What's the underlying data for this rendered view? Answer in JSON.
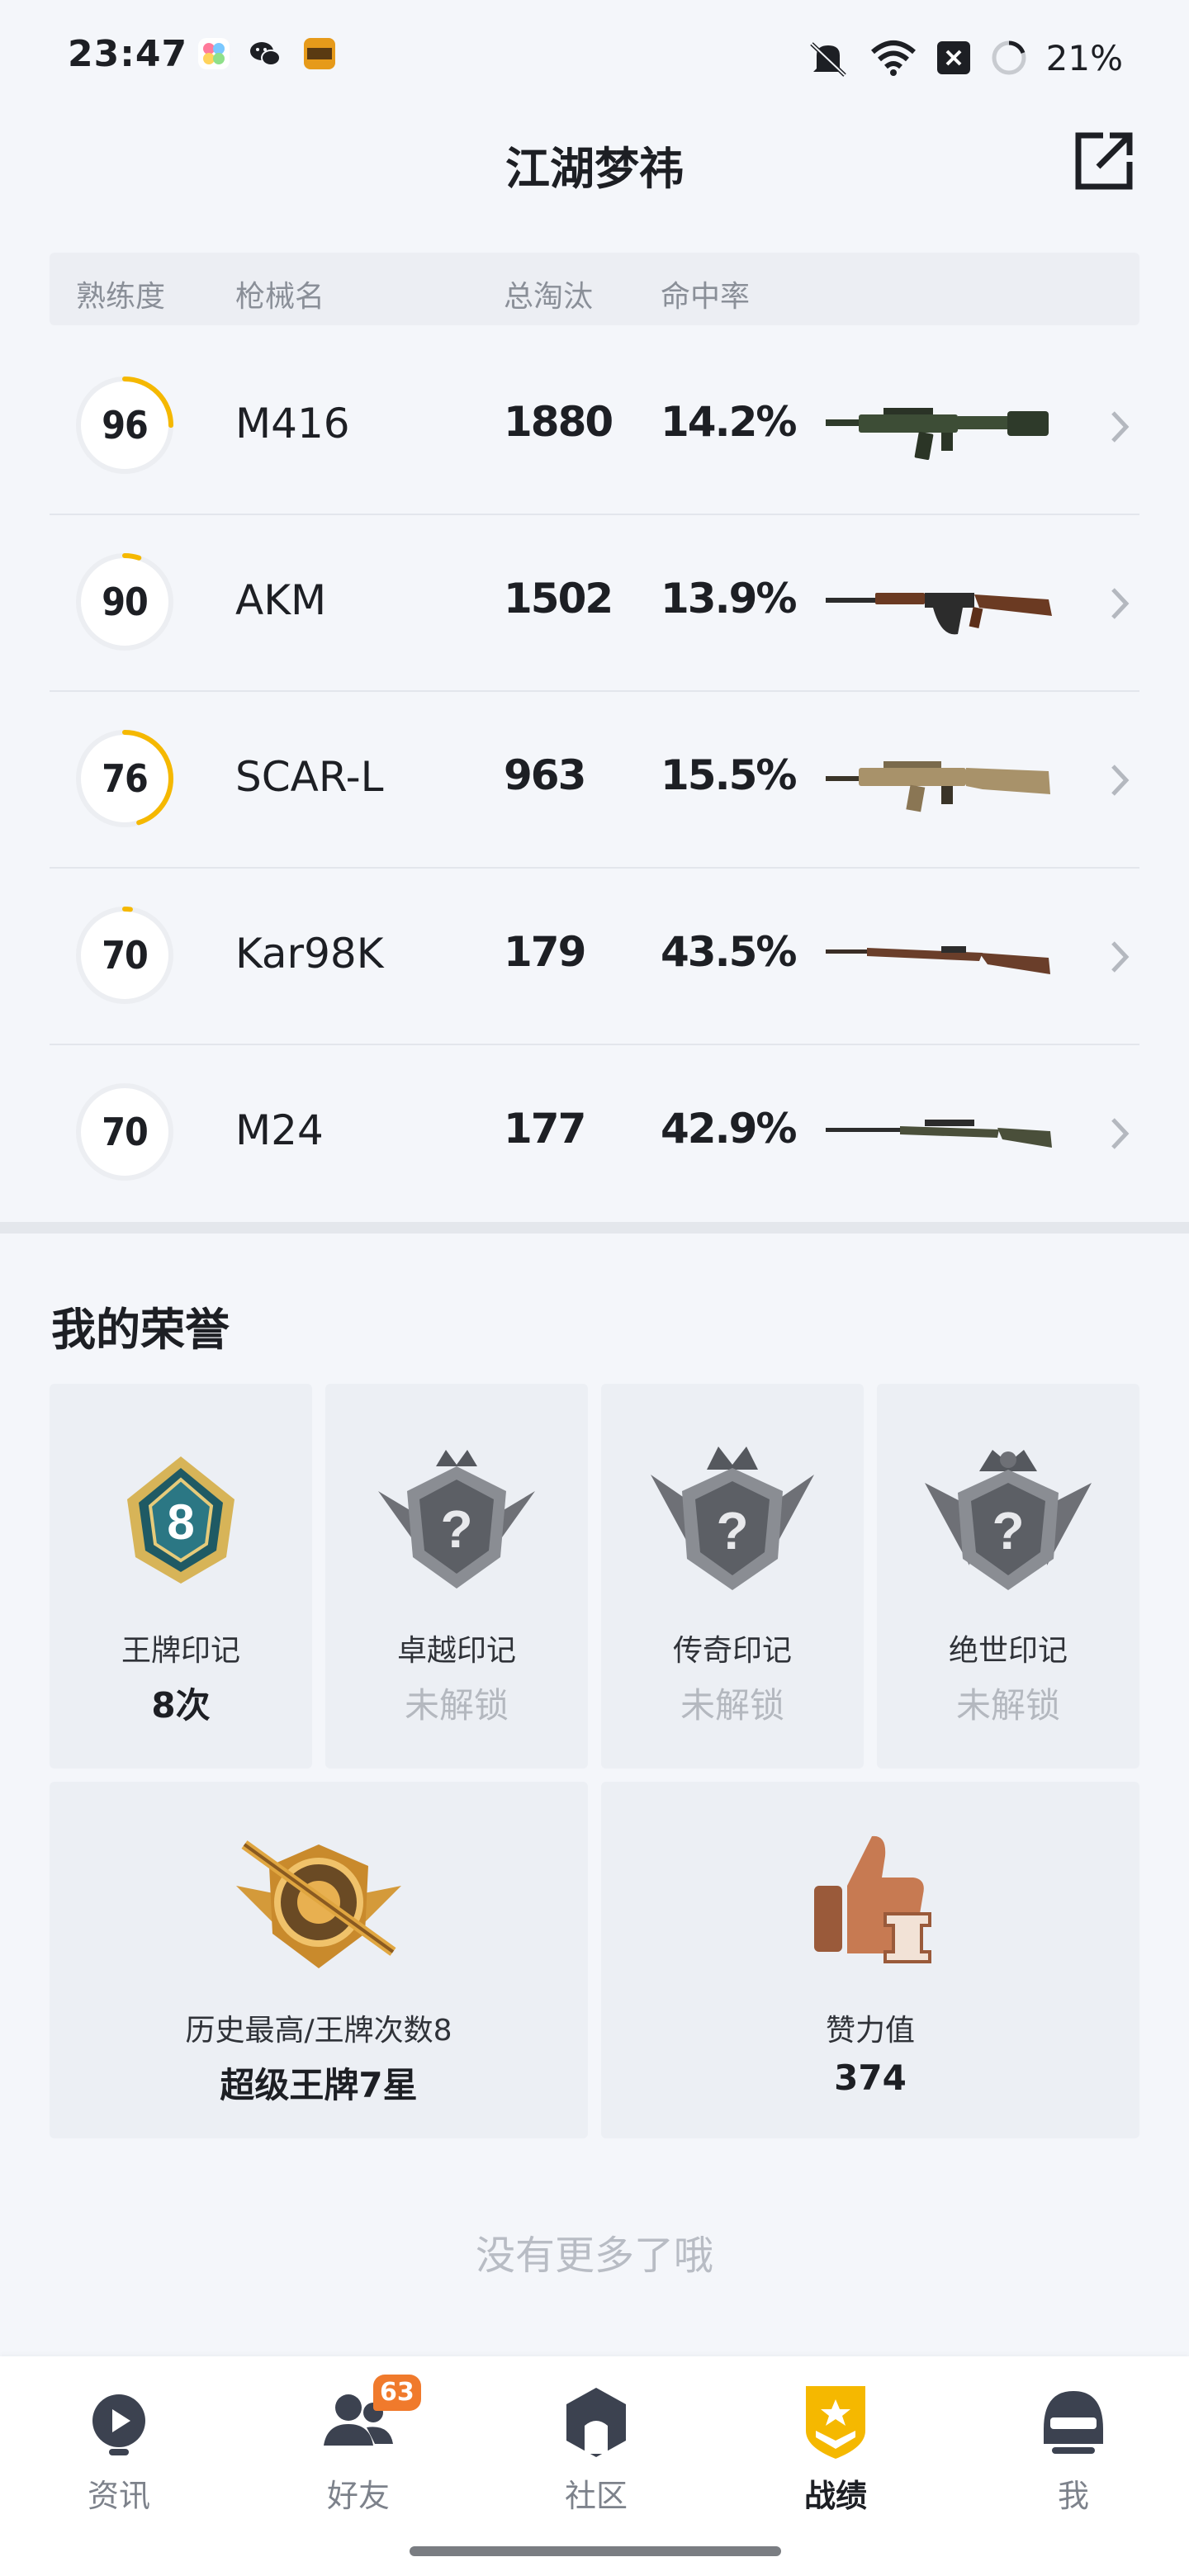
{
  "status_bar": {
    "time": "23:47",
    "battery_percent": "21%",
    "icons": [
      "photos-app-icon",
      "wechat-icon",
      "game-app-icon",
      "mute-icon",
      "wifi-icon",
      "sim-off-icon",
      "battery-ring-icon"
    ]
  },
  "header": {
    "title": "江湖梦祎",
    "share_icon": "share-external-icon"
  },
  "table": {
    "columns": {
      "proficiency": "熟练度",
      "gun_name": "枪械名",
      "kills": "总淘汰",
      "accuracy": "命中率"
    },
    "rows": [
      {
        "proficiency": "96",
        "progress": 0.25,
        "name": "M416",
        "kills": "1880",
        "accuracy": "14.2%",
        "gun_icon": "m416-rifle-icon"
      },
      {
        "proficiency": "90",
        "progress": 0.05,
        "name": "AKM",
        "kills": "1502",
        "accuracy": "13.9%",
        "gun_icon": "akm-rifle-icon"
      },
      {
        "proficiency": "76",
        "progress": 0.45,
        "name": "SCAR-L",
        "kills": "963",
        "accuracy": "15.5%",
        "gun_icon": "scarl-rifle-icon"
      },
      {
        "proficiency": "70",
        "progress": 0.02,
        "name": "Kar98K",
        "kills": "179",
        "accuracy": "43.5%",
        "gun_icon": "kar98k-rifle-icon"
      },
      {
        "proficiency": "70",
        "progress": 0.0,
        "name": "M24",
        "kills": "177",
        "accuracy": "42.9%",
        "gun_icon": "m24-rifle-icon"
      }
    ],
    "accent_color": "#f5b800"
  },
  "honors": {
    "title": "我的荣誉",
    "small_cards": [
      {
        "name": "王牌印记",
        "value": "8次",
        "locked": false,
        "badge_number": "8",
        "icon": "ace-seal-badge-icon"
      },
      {
        "name": "卓越印记",
        "value": "未解锁",
        "locked": true,
        "icon": "excellence-seal-badge-icon"
      },
      {
        "name": "传奇印记",
        "value": "未解锁",
        "locked": true,
        "icon": "legend-seal-badge-icon"
      },
      {
        "name": "绝世印记",
        "value": "未解锁",
        "locked": true,
        "icon": "peerless-seal-badge-icon"
      }
    ],
    "large_cards": [
      {
        "name": "历史最高/王牌次数8",
        "value": "超级王牌7星",
        "icon": "super-ace-rank-badge-icon"
      },
      {
        "name": "赞力值",
        "value": "374",
        "icon": "thumbs-up-trophy-icon"
      }
    ]
  },
  "footer_text": "没有更多了哦",
  "bottom_nav": {
    "items": [
      {
        "label": "资讯",
        "icon": "news-icon",
        "active": false
      },
      {
        "label": "好友",
        "icon": "friends-icon",
        "active": false,
        "badge": "63"
      },
      {
        "label": "社区",
        "icon": "community-icon",
        "active": false
      },
      {
        "label": "战绩",
        "icon": "record-badge-icon",
        "active": true
      },
      {
        "label": "我",
        "icon": "helmet-profile-icon",
        "active": false
      }
    ],
    "badge_color": "#f07a2c"
  }
}
